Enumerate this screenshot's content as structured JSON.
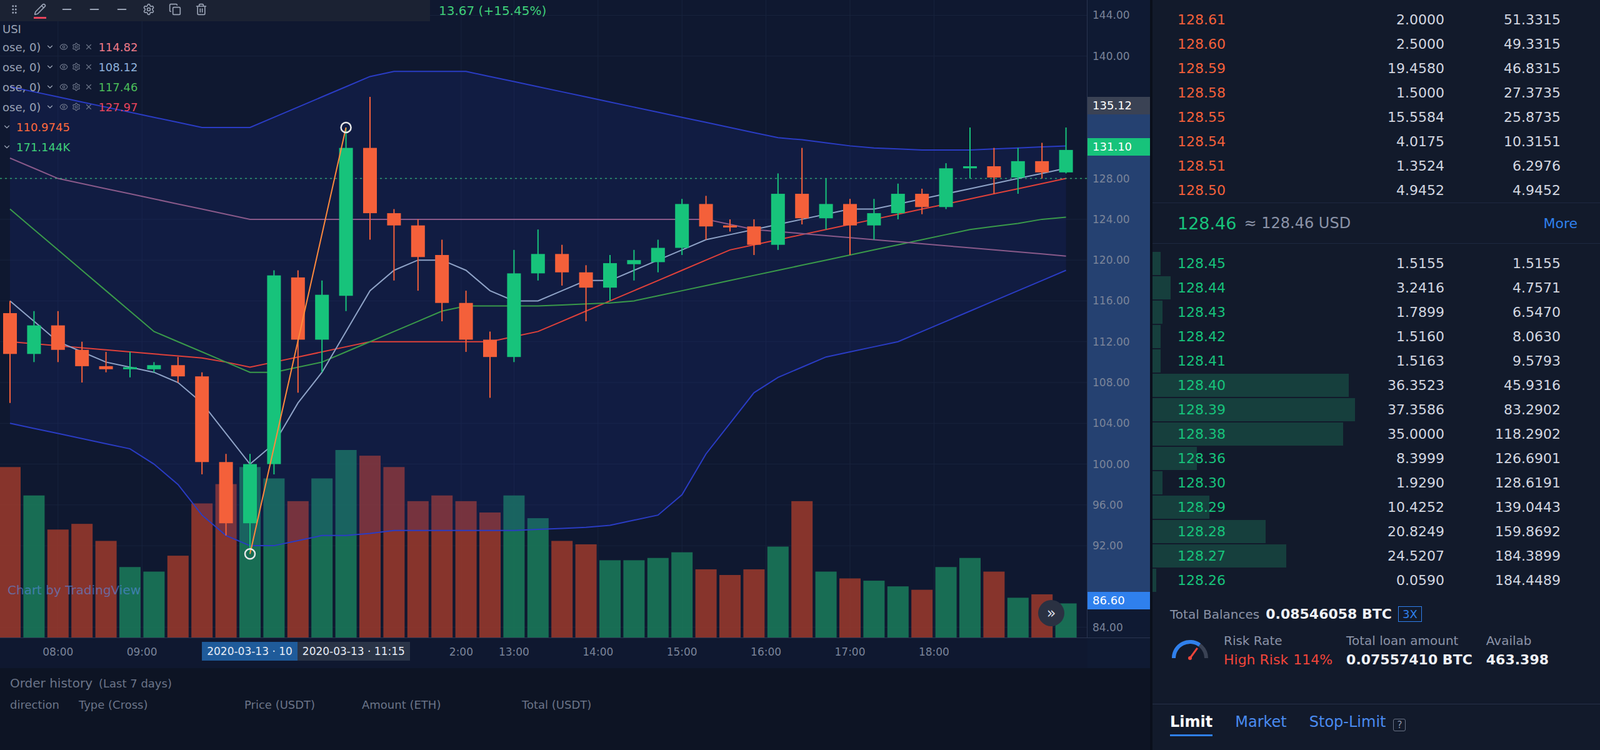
{
  "header": {
    "symbol": "USI",
    "change": "13.67 (+15.45%)"
  },
  "legend": [
    {
      "label": "ose, 0)",
      "value": "114.82",
      "color": "#ef7b8a"
    },
    {
      "label": "ose, 0)",
      "value": "108.12",
      "color": "#8fb3dc"
    },
    {
      "label": "ose, 0)",
      "value": "117.46",
      "color": "#4cbf5a"
    },
    {
      "label": "ose, 0)",
      "value": "127.97",
      "color": "#e8445c"
    },
    {
      "value": "110.9745",
      "color": "#ff6a3d"
    },
    {
      "value": "171.144K",
      "color": "#3fcf7a"
    }
  ],
  "chart": {
    "candles": [
      [
        114.8,
        116,
        106,
        110.8,
        150
      ],
      [
        110.8,
        115,
        110,
        113.6,
        125
      ],
      [
        113.6,
        115,
        110,
        111.2,
        95
      ],
      [
        111.2,
        112,
        108,
        109.6,
        100
      ],
      [
        109.6,
        111,
        109,
        109.3,
        85
      ],
      [
        109.3,
        111,
        108.5,
        109.5,
        62
      ],
      [
        109.3,
        110,
        109,
        109.7,
        58
      ],
      [
        109.7,
        110.5,
        108,
        108.6,
        72
      ],
      [
        108.6,
        109,
        99,
        100.2,
        118
      ],
      [
        100.2,
        101,
        93,
        94.2,
        135
      ],
      [
        94.2,
        101,
        91.2,
        100,
        150
      ],
      [
        100,
        119,
        99,
        118.5,
        140
      ],
      [
        118.3,
        119,
        107,
        112.2,
        120
      ],
      [
        112.2,
        118,
        109,
        116.6,
        140
      ],
      [
        116.5,
        133,
        115,
        131,
        165
      ],
      [
        131,
        136,
        122,
        124.6,
        160
      ],
      [
        124.6,
        125,
        118,
        123.4,
        150
      ],
      [
        123.4,
        124,
        117,
        120.3,
        120
      ],
      [
        120.5,
        122,
        114,
        115.8,
        125
      ],
      [
        115.8,
        117,
        111,
        112.2,
        120
      ],
      [
        112.2,
        113,
        106.5,
        110.5,
        110
      ],
      [
        110.5,
        121,
        110,
        118.7,
        125
      ],
      [
        118.7,
        123,
        118,
        120.6,
        105
      ],
      [
        120.6,
        121.5,
        117.5,
        118.8,
        85
      ],
      [
        118.8,
        119.5,
        114,
        117.3,
        82
      ],
      [
        117.3,
        120.5,
        116,
        119.7,
        68
      ],
      [
        119.6,
        121,
        118,
        120,
        68
      ],
      [
        119.8,
        122,
        118.8,
        121.2,
        70
      ],
      [
        121.2,
        126,
        120.5,
        125.5,
        75
      ],
      [
        125.5,
        126.3,
        122,
        123.3,
        60
      ],
      [
        123.4,
        124,
        122.8,
        123.2,
        55
      ],
      [
        123.3,
        124,
        120.5,
        121.5,
        60
      ],
      [
        121.5,
        128.5,
        121,
        126.5,
        80
      ],
      [
        126.5,
        131,
        123.5,
        124.1,
        120
      ],
      [
        124.1,
        128,
        123,
        125.5,
        58
      ],
      [
        125.5,
        126,
        120.5,
        123.4,
        52
      ],
      [
        123.4,
        126,
        122,
        124.6,
        50
      ],
      [
        124.6,
        127.5,
        124,
        126.5,
        45
      ],
      [
        126.5,
        127,
        124.5,
        125.2,
        42
      ],
      [
        125.2,
        129.5,
        125,
        129,
        62
      ],
      [
        129,
        133,
        128,
        129.2,
        70
      ],
      [
        129.2,
        131,
        126.5,
        128.1,
        58
      ],
      [
        128.1,
        131,
        126.5,
        129.7,
        35
      ],
      [
        129.7,
        131.5,
        128,
        128.6,
        38
      ],
      [
        128.6,
        133,
        128.5,
        130.8,
        30
      ]
    ],
    "bands": {
      "color": "#2a3cc4",
      "upper": [
        137,
        136.5,
        136,
        135.5,
        135,
        134.5,
        134,
        133.5,
        133,
        133,
        133,
        134,
        135,
        136,
        137,
        138,
        138.5,
        138.5,
        138.5,
        138.5,
        138,
        137.5,
        137,
        136.5,
        136,
        135.5,
        135,
        134.5,
        134,
        133.5,
        133,
        132.5,
        132,
        131.8,
        131.5,
        131.2,
        131,
        130.9,
        130.8,
        130.8,
        130.8,
        130.9,
        131,
        131.1,
        131.2
      ],
      "lower": [
        104,
        103.5,
        103,
        102.5,
        102,
        101.5,
        100,
        98,
        95,
        93,
        92,
        92,
        92.5,
        93,
        93,
        93.2,
        93.5,
        93.5,
        93.5,
        93.5,
        93.5,
        93.5,
        93.6,
        93.7,
        93.8,
        94,
        94.5,
        95,
        97,
        101,
        104,
        107,
        108.5,
        109.5,
        110.5,
        111,
        111.5,
        112,
        113,
        114,
        115,
        116,
        117,
        118,
        119
      ]
    },
    "lines": [
      {
        "name": "ma-red",
        "color": "#e0413a",
        "values": [
          112,
          111.8,
          111.6,
          111.4,
          111.2,
          111,
          110.8,
          110.6,
          110.4,
          110,
          109.5,
          110,
          110.5,
          111,
          111.5,
          112,
          112,
          112,
          112,
          112,
          112,
          112.5,
          113,
          114,
          115,
          116,
          117,
          118,
          119,
          120,
          121,
          121.5,
          122,
          122.5,
          123,
          123.5,
          124,
          124.5,
          125,
          125.5,
          126,
          126.5,
          127,
          127.5,
          128
        ]
      },
      {
        "name": "ma-green",
        "color": "#3a9a4a",
        "values": [
          125,
          123,
          121,
          119,
          117,
          115,
          113,
          112,
          111,
          110,
          109,
          109,
          109.5,
          110,
          111,
          112,
          113,
          114,
          115,
          115.5,
          115.5,
          115.5,
          115.5,
          115.6,
          115.7,
          115.8,
          116,
          116.5,
          117,
          117.5,
          118,
          118.5,
          119,
          119.5,
          120,
          120.5,
          121,
          121.5,
          122,
          122.5,
          123,
          123.3,
          123.6,
          124,
          124.2
        ]
      },
      {
        "name": "ma-fast",
        "color": "#8fa3c7",
        "values": [
          116,
          114,
          112,
          111,
          110,
          109.5,
          109,
          108,
          106,
          103,
          100,
          102,
          106,
          109,
          113,
          117,
          119,
          120,
          120,
          119,
          117,
          116,
          116,
          117,
          118,
          118,
          119,
          120,
          121,
          122,
          122.5,
          123,
          123.5,
          124,
          124.5,
          125,
          125,
          125.5,
          126,
          126.5,
          127,
          127.5,
          128,
          128.5,
          129
        ]
      },
      {
        "name": "ma-purple",
        "color": "#8a5a8a",
        "values": [
          130,
          129,
          128,
          127.5,
          127,
          126.5,
          126,
          125.5,
          125,
          124.5,
          124,
          124,
          124,
          124,
          124,
          124,
          124,
          124,
          124,
          124,
          124,
          124,
          124,
          124,
          124,
          124,
          124,
          124,
          124,
          124,
          123.5,
          123,
          122.8,
          122.6,
          122.4,
          122.2,
          122,
          121.8,
          121.6,
          121.4,
          121.2,
          121,
          120.8,
          120.6,
          120.4
        ]
      }
    ],
    "price_line": {
      "value": 128.0,
      "color": "#3ddc84"
    },
    "drawing": {
      "from": {
        "index": 10,
        "value": 91.2
      },
      "to": {
        "index": 14,
        "value": 133
      },
      "color": "#ff8a3d"
    },
    "watermark": "Chart by TradingView",
    "scroll_button": "»"
  },
  "price_axis": {
    "ticks": [
      {
        "text": "144.00",
        "value": 144
      },
      {
        "text": "140.00",
        "value": 140
      },
      {
        "text": "128.00",
        "value": 128
      },
      {
        "text": "124.00",
        "value": 124
      },
      {
        "text": "120.00",
        "value": 120
      },
      {
        "text": "116.00",
        "value": 116
      },
      {
        "text": "112.00",
        "value": 112
      },
      {
        "text": "108.00",
        "value": 108
      },
      {
        "text": "104.00",
        "value": 104
      },
      {
        "text": "100.00",
        "value": 100
      },
      {
        "text": "96.00",
        "value": 96
      },
      {
        "text": "92.00",
        "value": 92
      },
      {
        "text": "84.00",
        "value": 84
      }
    ],
    "range": {
      "from": 86.6,
      "to": 135.12
    },
    "markers": [
      {
        "text": "135.12",
        "value": 135.12,
        "kind": "crosshair"
      },
      {
        "text": "131.10",
        "value": 131.1,
        "kind": "last"
      },
      {
        "text": "86.60",
        "value": 86.6,
        "kind": "range"
      }
    ]
  },
  "time_axis": [
    {
      "text": "08:00",
      "index": 2,
      "kind": "plain"
    },
    {
      "text": "09:00",
      "index": 5.5,
      "kind": "plain"
    },
    {
      "text": "2020-03-13 · 10",
      "index": 8,
      "kind": "start"
    },
    {
      "text": "2020-03-13 · 11:15",
      "index": 8,
      "kind": "end"
    },
    {
      "text": "2:00",
      "index": 18.8,
      "kind": "plain"
    },
    {
      "text": "13:00",
      "index": 21,
      "kind": "plain"
    },
    {
      "text": "14:00",
      "index": 24.5,
      "kind": "plain"
    },
    {
      "text": "15:00",
      "index": 28,
      "kind": "plain"
    },
    {
      "text": "16:00",
      "index": 31.5,
      "kind": "plain"
    },
    {
      "text": "17:00",
      "index": 35,
      "kind": "plain"
    },
    {
      "text": "18:00",
      "index": 38.5,
      "kind": "plain"
    }
  ],
  "order_history": {
    "title": "Order history",
    "subtitle": "(Last 7 days)",
    "columns": [
      "direction",
      "Type (Cross)",
      "Price (USDT)",
      "Amount (ETH)",
      "Total (USDT)"
    ]
  },
  "order_book": {
    "asks": [
      {
        "price": "128.61",
        "amount": "2.0000",
        "total": "51.3315"
      },
      {
        "price": "128.60",
        "amount": "2.5000",
        "total": "49.3315"
      },
      {
        "price": "128.59",
        "amount": "19.4580",
        "total": "46.8315"
      },
      {
        "price": "128.58",
        "amount": "1.5000",
        "total": "27.3735"
      },
      {
        "price": "128.55",
        "amount": "15.5584",
        "total": "25.8735"
      },
      {
        "price": "128.54",
        "amount": "4.0175",
        "total": "10.3151"
      },
      {
        "price": "128.51",
        "amount": "1.3524",
        "total": "6.2976"
      },
      {
        "price": "128.50",
        "amount": "4.9452",
        "total": "4.9452"
      }
    ],
    "mid": {
      "price": "128.46",
      "approx": "≈ 128.46 USD",
      "more": "More"
    },
    "bids": [
      {
        "price": "128.45",
        "amount": "1.5155",
        "total": "1.5155",
        "level": 0.04
      },
      {
        "price": "128.44",
        "amount": "3.2416",
        "total": "4.7571",
        "level": 0.09
      },
      {
        "price": "128.43",
        "amount": "1.7899",
        "total": "6.5470",
        "level": 0.05
      },
      {
        "price": "128.42",
        "amount": "1.5160",
        "total": "8.0630",
        "level": 0.04
      },
      {
        "price": "128.41",
        "amount": "1.5163",
        "total": "9.5793",
        "level": 0.04
      },
      {
        "price": "128.40",
        "amount": "36.3523",
        "total": "45.9316",
        "level": 0.97
      },
      {
        "price": "128.39",
        "amount": "37.3586",
        "total": "83.2902",
        "level": 1
      },
      {
        "price": "128.38",
        "amount": "35.0000",
        "total": "118.2902",
        "level": 0.94
      },
      {
        "price": "128.36",
        "amount": "8.3999",
        "total": "126.6901",
        "level": 0.22
      },
      {
        "price": "128.30",
        "amount": "1.9290",
        "total": "128.6191",
        "level": 0.05
      },
      {
        "price": "128.29",
        "amount": "10.4252",
        "total": "139.0443",
        "level": 0.28
      },
      {
        "price": "128.28",
        "amount": "20.8249",
        "total": "159.8692",
        "level": 0.56
      },
      {
        "price": "128.27",
        "amount": "24.5207",
        "total": "184.3899",
        "level": 0.66
      },
      {
        "price": "128.26",
        "amount": "0.0590",
        "total": "184.4489",
        "level": 0.02
      }
    ]
  },
  "account": {
    "balance_label": "Total Balances",
    "balance": "0.08546058 BTC",
    "leverage": "3X",
    "risk_label": "Risk Rate",
    "risk_state": "High Risk",
    "risk_value": "114%",
    "gauge_level": 0.7,
    "loan_label": "Total loan amount",
    "loan": "0.07557410 BTC",
    "available_label": "Availab",
    "available": "463.398"
  },
  "order_tabs": [
    {
      "label": "Limit",
      "selected": true
    },
    {
      "label": "Market",
      "selected": false
    },
    {
      "label": "Stop-Limit",
      "selected": false
    }
  ],
  "help": "?"
}
